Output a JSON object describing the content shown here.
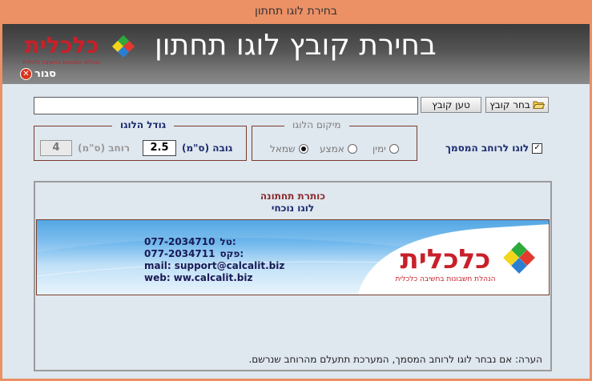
{
  "window": {
    "title": "בחירת לוגו תחתון"
  },
  "header": {
    "title": "בחירת קובץ לוגו תחתון",
    "close_label": "סגור",
    "logo_text": "כלכלית",
    "logo_tagline": "הנהלת חשבונות בחשיבה כלכלית"
  },
  "file": {
    "path_value": "",
    "choose_button": "בחר קובץ",
    "load_button": "טען קובץ"
  },
  "position": {
    "legend": "מיקום הלוגו",
    "options": [
      "ימין",
      "אמצע",
      "שמאל"
    ],
    "selected": "שמאל"
  },
  "size": {
    "legend": "גודל הלוגו",
    "height_label": "גובה (ס\"מ)",
    "height_value": "2.5",
    "width_label": "רוחב (ס\"מ)",
    "width_value": "4"
  },
  "full_width": {
    "label": "לוגו לרוחב המסמך",
    "checked": true
  },
  "preview": {
    "title": "כותרת תחתונה",
    "subtitle": "לוגו נוכחי",
    "tel_label": "טל:",
    "tel": "077-2034710",
    "fax_label": "פקס:",
    "fax": "077-2034711",
    "mail": "mail: support@calcalit.biz",
    "web": "web: ww.calcalit.biz",
    "logo_text": "כלכלית",
    "logo_tagline": "הנהלת חשבונות בחשיבה כלכלית",
    "note": "הערה: אם נבחר לוגו לרוחב המסמך, המערכת תתעלם מהרוחב שנרשם."
  },
  "colors": {
    "accent": "#ec9066",
    "header_dark": "#3b3b3b",
    "legend_blue": "#1a2a6e",
    "border_brown": "#7a3b2a"
  }
}
